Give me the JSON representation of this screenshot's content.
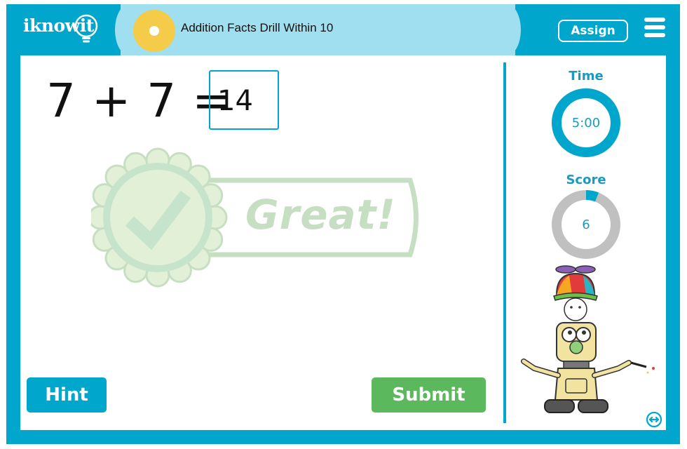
{
  "header": {
    "logo": "iknowit",
    "title": "Addition Facts Drill Within 10",
    "assign_label": "Assign",
    "menu_icon": "hamburger-menu-icon"
  },
  "colors": {
    "brand_blue": "#00a6cc",
    "header_light_blue": "#a0dff0",
    "title_dot": "#f5cc4a",
    "submit_green": "#5cb85c",
    "feedback_green": "#c6dfc2",
    "ring_gray": "#c0c0c0"
  },
  "problem": {
    "equation": "7 + 7 =",
    "operand_a": "7",
    "operator": "+",
    "operand_b": "7",
    "equals": "=",
    "answer_value": "14"
  },
  "feedback": {
    "text": "Great!",
    "icon": "check-badge-icon"
  },
  "buttons": {
    "hint_label": "Hint",
    "submit_label": "Submit"
  },
  "sidebar": {
    "time_label": "Time",
    "time_value": "5:00",
    "time_progress_fraction": 1.0,
    "score_label": "Score",
    "score_value": "6",
    "score_progress_fraction": 0.06,
    "mascot": "robot-with-bunny-and-propeller-hat",
    "swap_icon": "swap-horizontal-icon"
  }
}
